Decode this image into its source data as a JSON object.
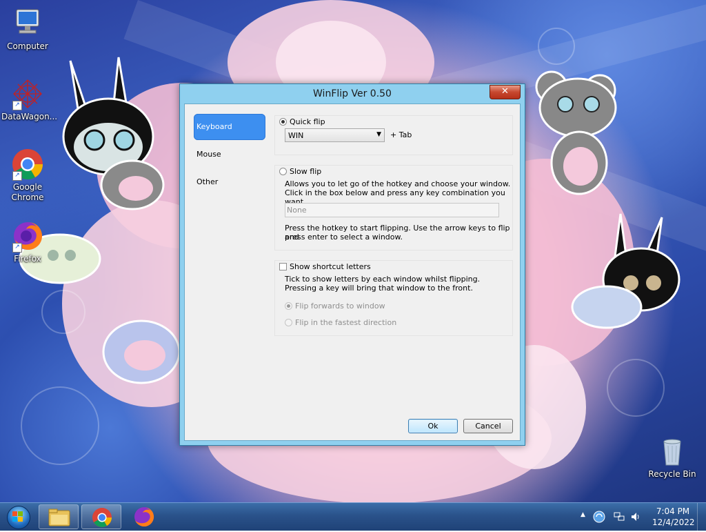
{
  "desktop": {
    "icons": [
      {
        "label": "Computer"
      },
      {
        "label": "DataWagon..."
      },
      {
        "label": "Google Chrome"
      },
      {
        "label": "Firefox"
      },
      {
        "label": "Recycle Bin"
      }
    ]
  },
  "dialog": {
    "title": "WinFlip Ver 0.50",
    "close_label": "✕",
    "nav": [
      {
        "label": "Keyboard",
        "active": true
      },
      {
        "label": "Mouse",
        "active": false
      },
      {
        "label": "Other",
        "active": false
      }
    ],
    "quick_flip": {
      "label": "Quick flip",
      "selected": true,
      "hotkey_value": "WIN",
      "suffix": "+ Tab"
    },
    "slow_flip": {
      "label": "Slow flip",
      "selected": false,
      "description_line1": "Allows you to let go of the hotkey and choose your window.",
      "description_line2": "Click in the box below and press any key combination you want.",
      "hotkey_placeholder": "None",
      "help_line1": "Press the hotkey to start flipping. Use the arrow keys to flip and",
      "help_line2": "press enter to select a window."
    },
    "shortcut_letters": {
      "label": "Show shortcut letters",
      "checked": false,
      "description_line1": "Tick to show letters by each window whilst flipping.",
      "description_line2": "Pressing a key will bring that window to the front.",
      "option_forwards": "Flip forwards to window",
      "option_fastest": "Flip in the fastest direction"
    },
    "buttons": {
      "ok": "Ok",
      "cancel": "Cancel"
    }
  },
  "taskbar": {
    "time": "7:04 PM",
    "date": "12/4/2022",
    "tray_arrow": "▲"
  },
  "colors": {
    "accent": "#3d8ff0",
    "dialog_frame": "#8fd0ef",
    "close_button": "#c7482f"
  }
}
